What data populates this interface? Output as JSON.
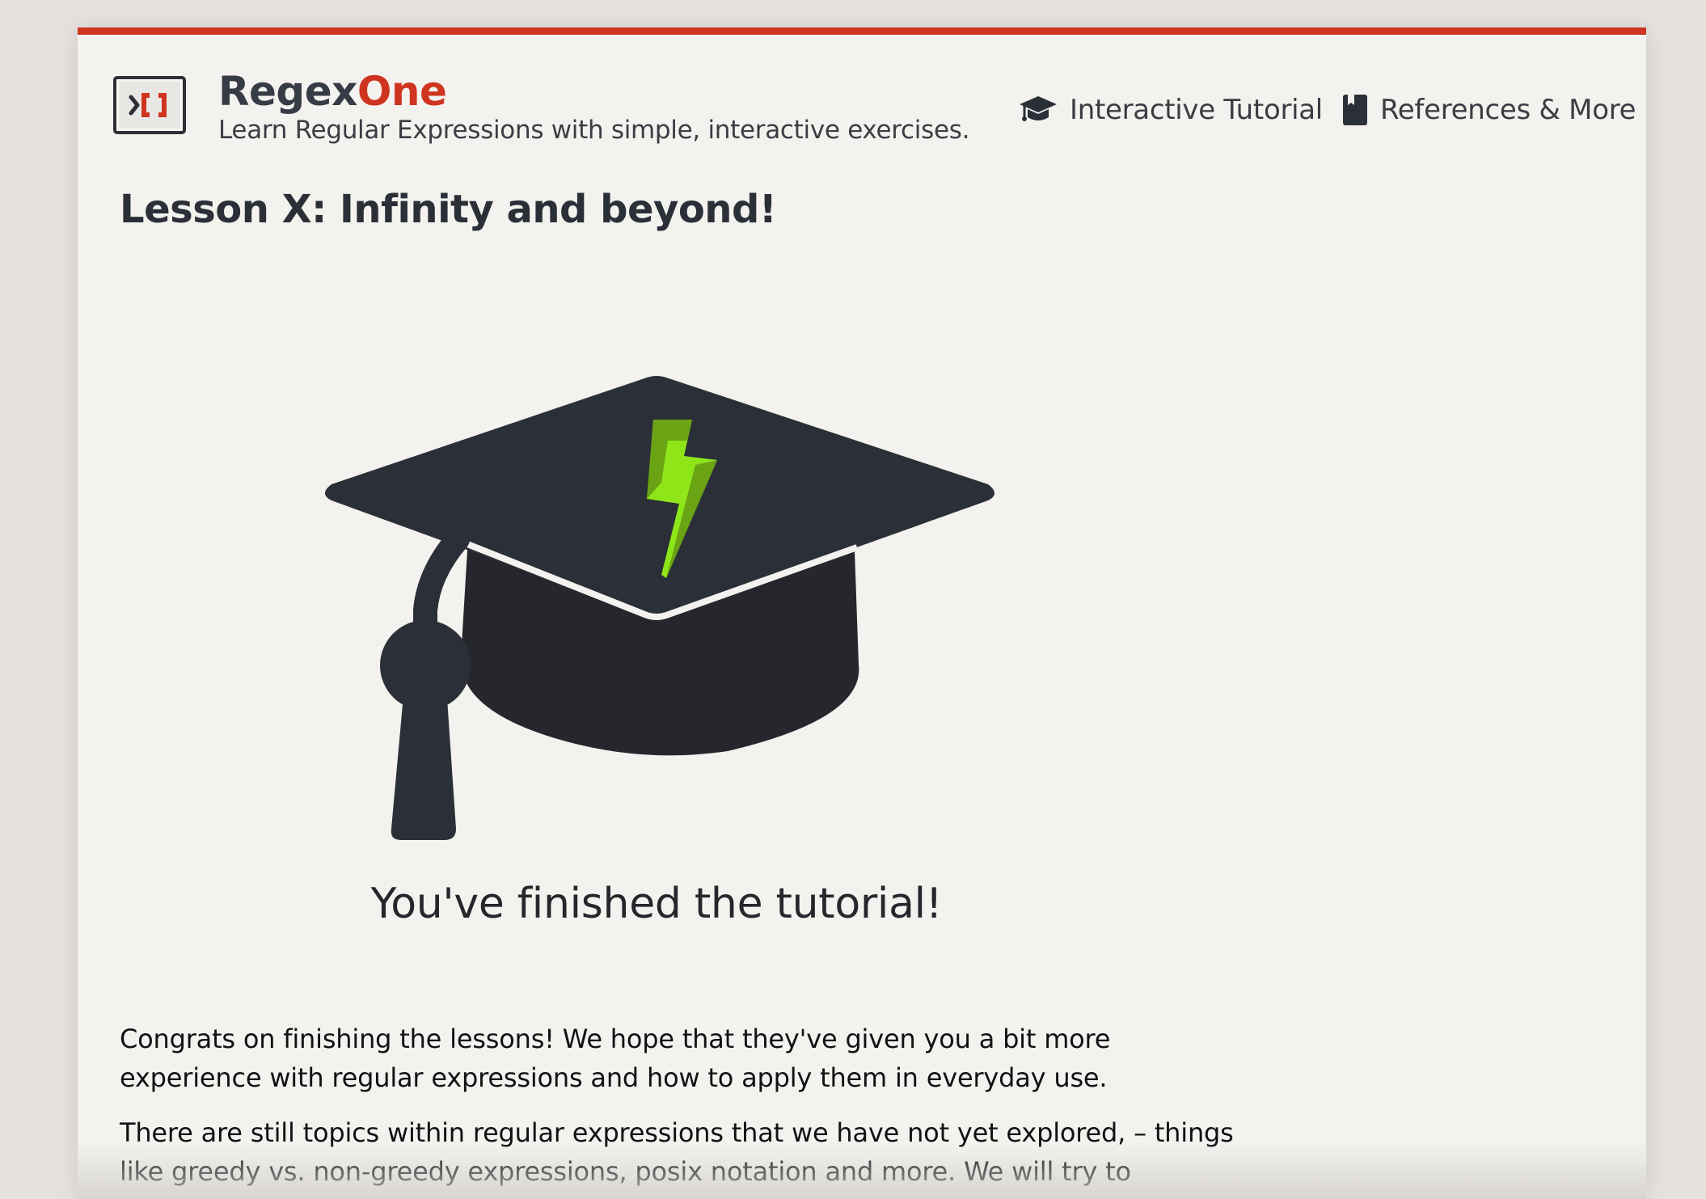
{
  "header": {
    "brand_first": "Regex",
    "brand_second": "One",
    "tagline": "Learn Regular Expressions with simple, interactive exercises.",
    "logo_icon": "regex-terminal-logo-icon"
  },
  "nav": {
    "items": [
      {
        "label": "Interactive Tutorial",
        "icon": "graduation-cap-icon"
      },
      {
        "label": "References & More",
        "icon": "book-icon"
      }
    ]
  },
  "lesson": {
    "title": "Lesson X: Infinity and beyond!",
    "illustration_icon": "graduation-cap-lightning-icon",
    "finished_message": "You've finished the tutorial!",
    "paragraphs": [
      "Congrats on finishing the lessons! We hope that they've given you a bit more experience with regular expressions and how to apply them in everyday use.",
      "There are still topics within regular expressions that we have not yet explored, – things like greedy vs. non-greedy expressions, posix notation and more. We will try to elaborate more on these in future lessons."
    ]
  },
  "colors": {
    "accent_red": "#cf3420",
    "dark": "#2b2f37",
    "page_bg": "#f3f2ee",
    "bolt_green": "#8ee619"
  }
}
